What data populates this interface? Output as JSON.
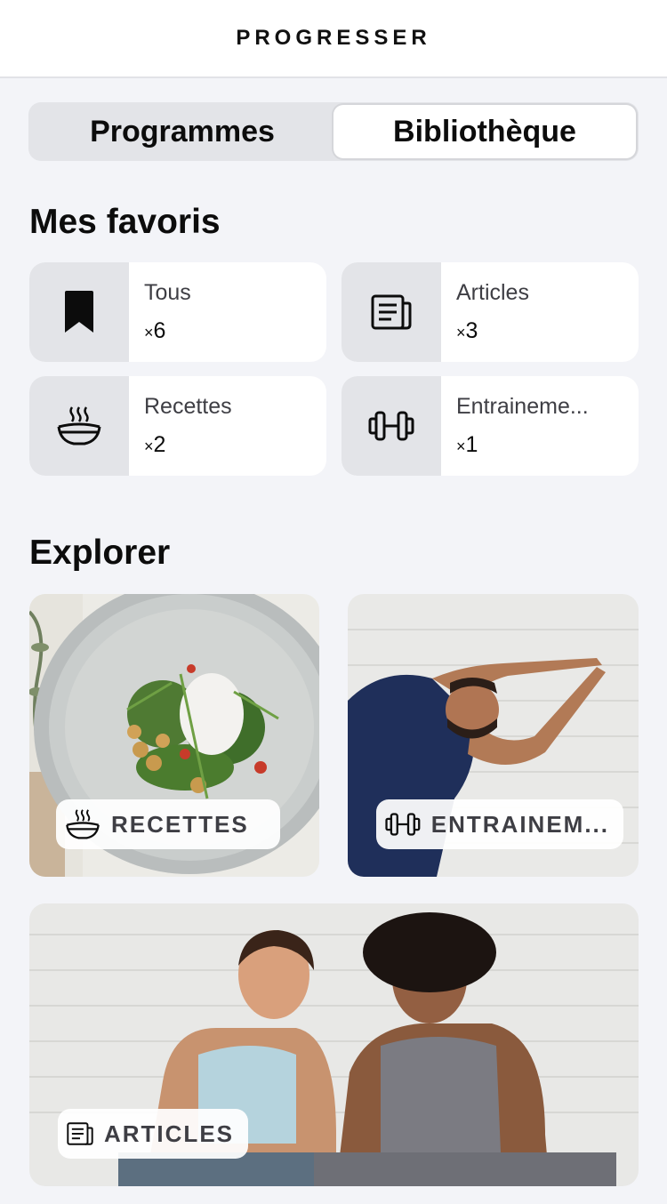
{
  "header": {
    "title": "PROGRESSER"
  },
  "tabs": [
    {
      "label": "Programmes",
      "active": false
    },
    {
      "label": "Bibliothèque",
      "active": true
    }
  ],
  "favorites": {
    "title": "Mes favoris",
    "items": [
      {
        "label": "Tous",
        "count_prefix": "×",
        "count": "6",
        "icon": "bookmark-icon"
      },
      {
        "label": "Articles",
        "count_prefix": "×",
        "count": "3",
        "icon": "newspaper-icon"
      },
      {
        "label": "Recettes",
        "count_prefix": "×",
        "count": "2",
        "icon": "soup-bowl-icon"
      },
      {
        "label": "Entraineme...",
        "count_prefix": "×",
        "count": "1",
        "icon": "dumbbell-icon"
      }
    ]
  },
  "explore": {
    "title": "Explorer",
    "tiles": [
      {
        "label": "RECETTES",
        "icon": "soup-bowl-icon",
        "image": "salad-bowl-photo"
      },
      {
        "label": "ENTRAINEM...",
        "icon": "dumbbell-icon",
        "image": "man-stretching-photo"
      },
      {
        "label": "ARTICLES",
        "icon": "newspaper-icon",
        "image": "two-women-sitting-photo"
      }
    ]
  },
  "colors": {
    "background": "#f3f4f8",
    "card": "#ffffff",
    "icon_panel": "#e3e4e8",
    "text": "#0c0c0c",
    "muted_text": "#3e3e44"
  }
}
